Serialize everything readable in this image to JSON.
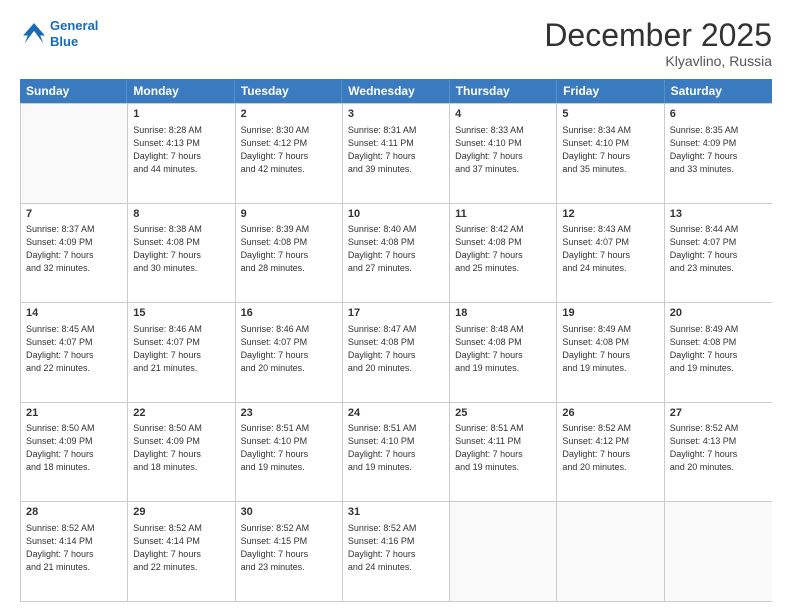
{
  "header": {
    "logo_line1": "General",
    "logo_line2": "Blue",
    "month": "December 2025",
    "location": "Klyavlino, Russia"
  },
  "weekdays": [
    "Sunday",
    "Monday",
    "Tuesday",
    "Wednesday",
    "Thursday",
    "Friday",
    "Saturday"
  ],
  "rows": [
    [
      {
        "day": "",
        "info": ""
      },
      {
        "day": "1",
        "info": "Sunrise: 8:28 AM\nSunset: 4:13 PM\nDaylight: 7 hours\nand 44 minutes."
      },
      {
        "day": "2",
        "info": "Sunrise: 8:30 AM\nSunset: 4:12 PM\nDaylight: 7 hours\nand 42 minutes."
      },
      {
        "day": "3",
        "info": "Sunrise: 8:31 AM\nSunset: 4:11 PM\nDaylight: 7 hours\nand 39 minutes."
      },
      {
        "day": "4",
        "info": "Sunrise: 8:33 AM\nSunset: 4:10 PM\nDaylight: 7 hours\nand 37 minutes."
      },
      {
        "day": "5",
        "info": "Sunrise: 8:34 AM\nSunset: 4:10 PM\nDaylight: 7 hours\nand 35 minutes."
      },
      {
        "day": "6",
        "info": "Sunrise: 8:35 AM\nSunset: 4:09 PM\nDaylight: 7 hours\nand 33 minutes."
      }
    ],
    [
      {
        "day": "7",
        "info": "Sunrise: 8:37 AM\nSunset: 4:09 PM\nDaylight: 7 hours\nand 32 minutes."
      },
      {
        "day": "8",
        "info": "Sunrise: 8:38 AM\nSunset: 4:08 PM\nDaylight: 7 hours\nand 30 minutes."
      },
      {
        "day": "9",
        "info": "Sunrise: 8:39 AM\nSunset: 4:08 PM\nDaylight: 7 hours\nand 28 minutes."
      },
      {
        "day": "10",
        "info": "Sunrise: 8:40 AM\nSunset: 4:08 PM\nDaylight: 7 hours\nand 27 minutes."
      },
      {
        "day": "11",
        "info": "Sunrise: 8:42 AM\nSunset: 4:08 PM\nDaylight: 7 hours\nand 25 minutes."
      },
      {
        "day": "12",
        "info": "Sunrise: 8:43 AM\nSunset: 4:07 PM\nDaylight: 7 hours\nand 24 minutes."
      },
      {
        "day": "13",
        "info": "Sunrise: 8:44 AM\nSunset: 4:07 PM\nDaylight: 7 hours\nand 23 minutes."
      }
    ],
    [
      {
        "day": "14",
        "info": "Sunrise: 8:45 AM\nSunset: 4:07 PM\nDaylight: 7 hours\nand 22 minutes."
      },
      {
        "day": "15",
        "info": "Sunrise: 8:46 AM\nSunset: 4:07 PM\nDaylight: 7 hours\nand 21 minutes."
      },
      {
        "day": "16",
        "info": "Sunrise: 8:46 AM\nSunset: 4:07 PM\nDaylight: 7 hours\nand 20 minutes."
      },
      {
        "day": "17",
        "info": "Sunrise: 8:47 AM\nSunset: 4:08 PM\nDaylight: 7 hours\nand 20 minutes."
      },
      {
        "day": "18",
        "info": "Sunrise: 8:48 AM\nSunset: 4:08 PM\nDaylight: 7 hours\nand 19 minutes."
      },
      {
        "day": "19",
        "info": "Sunrise: 8:49 AM\nSunset: 4:08 PM\nDaylight: 7 hours\nand 19 minutes."
      },
      {
        "day": "20",
        "info": "Sunrise: 8:49 AM\nSunset: 4:08 PM\nDaylight: 7 hours\nand 19 minutes."
      }
    ],
    [
      {
        "day": "21",
        "info": "Sunrise: 8:50 AM\nSunset: 4:09 PM\nDaylight: 7 hours\nand 18 minutes."
      },
      {
        "day": "22",
        "info": "Sunrise: 8:50 AM\nSunset: 4:09 PM\nDaylight: 7 hours\nand 18 minutes."
      },
      {
        "day": "23",
        "info": "Sunrise: 8:51 AM\nSunset: 4:10 PM\nDaylight: 7 hours\nand 19 minutes."
      },
      {
        "day": "24",
        "info": "Sunrise: 8:51 AM\nSunset: 4:10 PM\nDaylight: 7 hours\nand 19 minutes."
      },
      {
        "day": "25",
        "info": "Sunrise: 8:51 AM\nSunset: 4:11 PM\nDaylight: 7 hours\nand 19 minutes."
      },
      {
        "day": "26",
        "info": "Sunrise: 8:52 AM\nSunset: 4:12 PM\nDaylight: 7 hours\nand 20 minutes."
      },
      {
        "day": "27",
        "info": "Sunrise: 8:52 AM\nSunset: 4:13 PM\nDaylight: 7 hours\nand 20 minutes."
      }
    ],
    [
      {
        "day": "28",
        "info": "Sunrise: 8:52 AM\nSunset: 4:14 PM\nDaylight: 7 hours\nand 21 minutes."
      },
      {
        "day": "29",
        "info": "Sunrise: 8:52 AM\nSunset: 4:14 PM\nDaylight: 7 hours\nand 22 minutes."
      },
      {
        "day": "30",
        "info": "Sunrise: 8:52 AM\nSunset: 4:15 PM\nDaylight: 7 hours\nand 23 minutes."
      },
      {
        "day": "31",
        "info": "Sunrise: 8:52 AM\nSunset: 4:16 PM\nDaylight: 7 hours\nand 24 minutes."
      },
      {
        "day": "",
        "info": ""
      },
      {
        "day": "",
        "info": ""
      },
      {
        "day": "",
        "info": ""
      }
    ]
  ]
}
